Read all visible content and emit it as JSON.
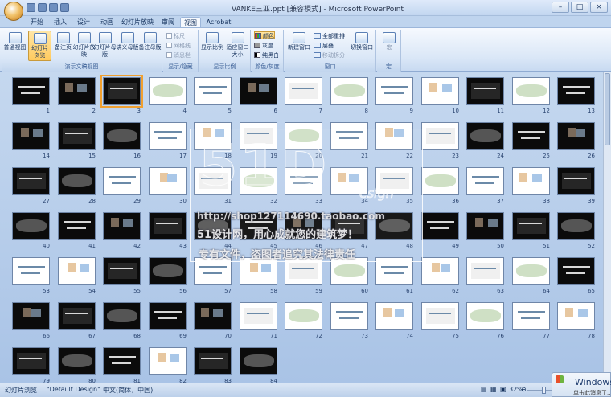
{
  "window": {
    "title": "VANKE三亚.ppt [兼容模式] - Microsoft PowerPoint",
    "controls": [
      "–",
      "□",
      "×"
    ]
  },
  "tabs": [
    "开始",
    "插入",
    "设计",
    "动画",
    "幻灯片放映",
    "审阅",
    "视图",
    "Acrobat"
  ],
  "active_tab": "视图",
  "ribbon": {
    "presentation_views": {
      "label": "演示文稿视图",
      "buttons": [
        "普通视图",
        "幻灯片浏览",
        "备注页",
        "幻灯片放映",
        "幻灯片母版",
        "讲义母版",
        "备注母版"
      ]
    },
    "show_hide": {
      "label": "显示/隐藏",
      "items": [
        "标尺",
        "网格线",
        "消息栏"
      ]
    },
    "zoom": {
      "label": "显示比例",
      "buttons": [
        "显示比例",
        "适应窗口大小"
      ]
    },
    "color": {
      "label": "颜色/灰度",
      "items": [
        "颜色",
        "灰度",
        "纯黑白"
      ]
    },
    "window": {
      "label": "窗口",
      "new_window": "新建窗口",
      "items": [
        "全部重排",
        "层叠",
        "移动拆分"
      ],
      "switch": "切换窗口"
    },
    "macros": {
      "label": "宏",
      "button": "宏"
    }
  },
  "slides": {
    "count": 84,
    "selected": 3,
    "light": [
      4,
      5,
      7,
      8,
      9,
      10,
      12,
      17,
      18,
      19,
      20,
      21,
      22,
      23,
      29,
      30,
      31,
      32,
      33,
      34,
      35,
      36,
      37,
      38,
      53,
      54,
      57,
      58,
      59,
      60,
      61,
      62,
      63,
      64,
      71,
      72,
      73,
      74,
      75,
      76,
      77,
      78,
      82
    ]
  },
  "watermark": {
    "big": "51D",
    "sub": "esign",
    "url": "http://shop127114690.taobao.com",
    "line1": "51设计网，用心成就您的建筑梦！",
    "line2": "专有文件，盗图者追究其法律责任"
  },
  "status": {
    "view": "幻灯片浏览",
    "theme": "\"Default Design\"",
    "language": "中文(简体，中国)",
    "zoom": "32%",
    "zoom_level": 0.32
  },
  "notification": {
    "title": "Windows",
    "text": "单击此消息了..."
  }
}
